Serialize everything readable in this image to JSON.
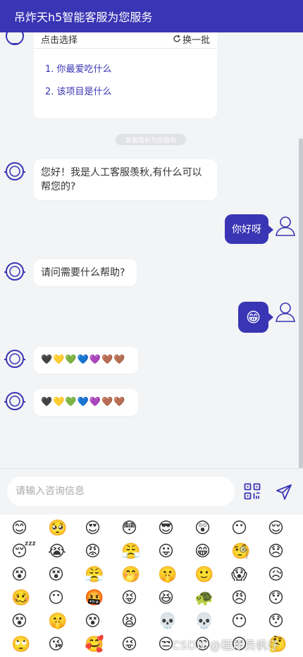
{
  "header": {
    "title": "吊炸天h5智能客服为您服务"
  },
  "question_card": {
    "select_label": "点击选择",
    "refresh_label": "换一批",
    "questions": [
      "1. 你最爱吃什么",
      "2. 该项目是什么"
    ]
  },
  "system_tag": "客服羡秋为您服务",
  "messages": {
    "agent_greeting": "您好！我是人工客服羡秋,有什么可以帮您的?",
    "user_text": "你好呀",
    "agent_help": "请问需要什么帮助?",
    "user_emoji": "😁",
    "hearts_1": [
      "🖤",
      "💛",
      "💚",
      "💙",
      "💜",
      "🤎",
      "🤎"
    ],
    "hearts_2": [
      "🖤",
      "💛",
      "💚",
      "💙",
      "💜",
      "🤎",
      "🤎"
    ]
  },
  "input": {
    "placeholder": "请输入咨询信息"
  },
  "icons": {
    "qr": "qr-code-icon",
    "send": "send-icon",
    "agent_avatar": "headset-icon",
    "user_avatar": "user-icon"
  },
  "emoji_panel": {
    "emojis": [
      "😊",
      "🥺",
      "😍",
      "😳",
      "😎",
      "😲",
      "😶",
      "😌",
      "😴",
      "😭",
      "😡",
      "😤",
      "😛",
      "😁",
      "🧐",
      "😞",
      "😵",
      "😵",
      "😤",
      "🤭",
      "🤫",
      "🙂",
      "😱",
      "😥",
      "🥴",
      "😶",
      "🤬",
      "😝",
      "😆",
      "🐢",
      "😠",
      "😯",
      "😵",
      "🤫",
      "😵",
      "😫",
      "💀",
      "💀",
      "😶",
      "😯",
      "🙄",
      "😘",
      "🥰",
      "😜",
      "😒",
      "😊",
      "😐",
      "🤔"
    ]
  },
  "watermark": "CSDN @程序员帆仔",
  "colors": {
    "primary": "#3a35b4",
    "background": "#f3f4f6"
  }
}
